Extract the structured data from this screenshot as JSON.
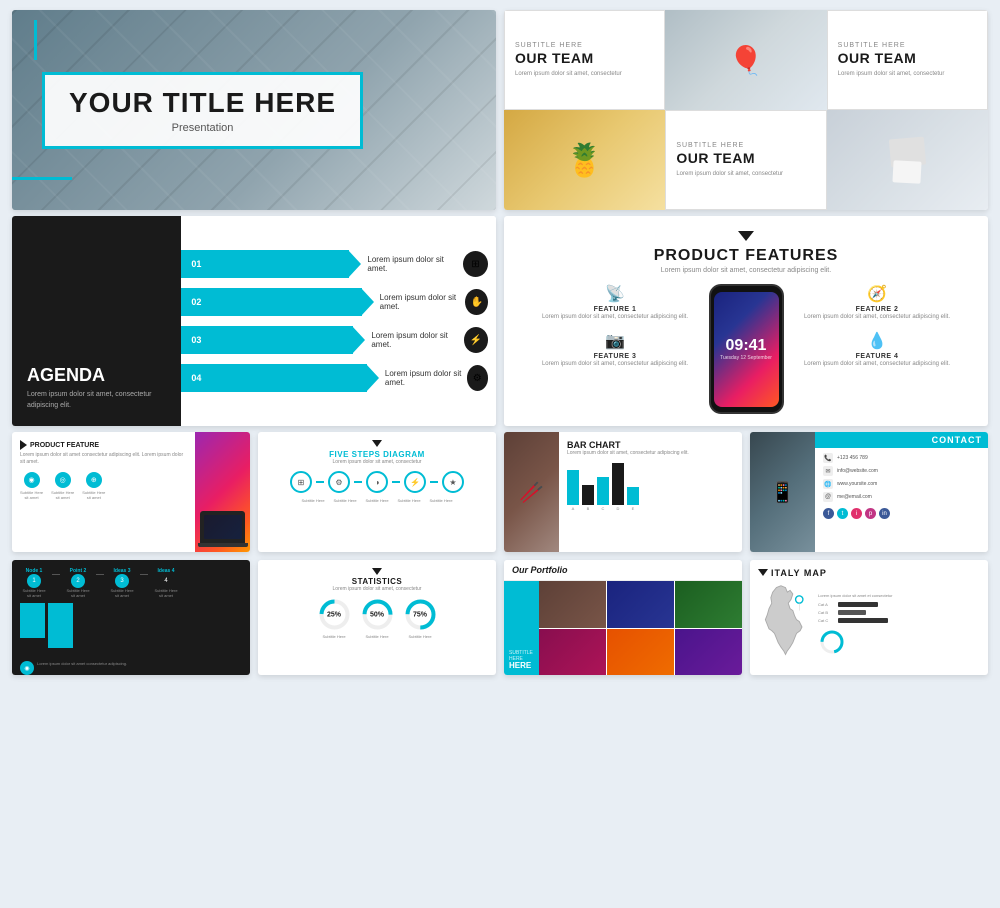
{
  "slide1": {
    "title": "YOUR TITLE HERE",
    "subtitle": "Presentation"
  },
  "ourTeam": {
    "subtitle": "SUBTITLE HERE",
    "title": "OUR TEAM",
    "body": "Lorem ipsum dolor sit amet, consectetur"
  },
  "agenda": {
    "title": "AGENDA",
    "body": "Lorem ipsum dolor sit amet, consectetur adipiscing elit.",
    "items": [
      {
        "num": "01",
        "text": "Lorem ipsum dolor sit amet."
      },
      {
        "num": "02",
        "text": "Lorem ipsum dolor sit amet."
      },
      {
        "num": "03",
        "text": "Lorem ipsum dolor sit amet."
      },
      {
        "num": "04",
        "text": "Lorem ipsum dolor sit amet."
      }
    ]
  },
  "features": {
    "title": "PRODUCT FEATURES",
    "sub": "Lorem ipsum dolor sit amet, consectetur adipiscing elit.",
    "items": [
      {
        "label": "FEATURE 1",
        "text": "Lorem ipsum dolor sit amet, consectetur adipiscing elit.",
        "icon": "📡"
      },
      {
        "label": "FEATURE 2",
        "text": "Lorem ipsum dolor sit amet, consectetur adipiscing elit.",
        "icon": "🧭"
      },
      {
        "label": "FEATURE 3",
        "text": "Lorem ipsum dolor sit amet, consectetur adipiscing elit.",
        "icon": "📷"
      },
      {
        "label": "FEATURE 4",
        "text": "Lorem ipsum dolor sit amet, consectetur adipiscing elit.",
        "icon": "💧"
      }
    ],
    "phone_time": "09:41",
    "phone_date": "Tuesday 12 September"
  },
  "productFeatureSmall": {
    "title": "PRODUCT FEATURE",
    "text": "Lorem ipsum dolor sit amet consectetur adipiscing elit."
  },
  "fiveSteps": {
    "title": "FIVE STEPS DIAGRAM",
    "sub": "Lorem ipsum dolor sit amet, consectetur"
  },
  "barChart": {
    "title": "BAR CHART",
    "sub": "Lorem ipsum dolor sit amet, consectetur adipiscing elit."
  },
  "contact": {
    "title": "CONTACT",
    "info": [
      "+123 456 789",
      "info@website.com",
      "www.yoursite.com",
      "me@email.com"
    ]
  },
  "statistics": {
    "title": "STATISTICS",
    "sub": "Lorem ipsum dolor sit amet, consectetur",
    "items": [
      {
        "pct": 25,
        "label": "Subtitle Here"
      },
      {
        "pct": 50,
        "label": "Subtitle Here"
      },
      {
        "pct": 75,
        "label": "Subtitle Here"
      }
    ]
  },
  "portfolio": {
    "title": "Our Portfolio",
    "subtitle": "SUBTITLE HERE"
  },
  "italyMap": {
    "title": "ITALY MAP",
    "sub": "Lorem ipsum dolor sit amet et consectetur"
  }
}
